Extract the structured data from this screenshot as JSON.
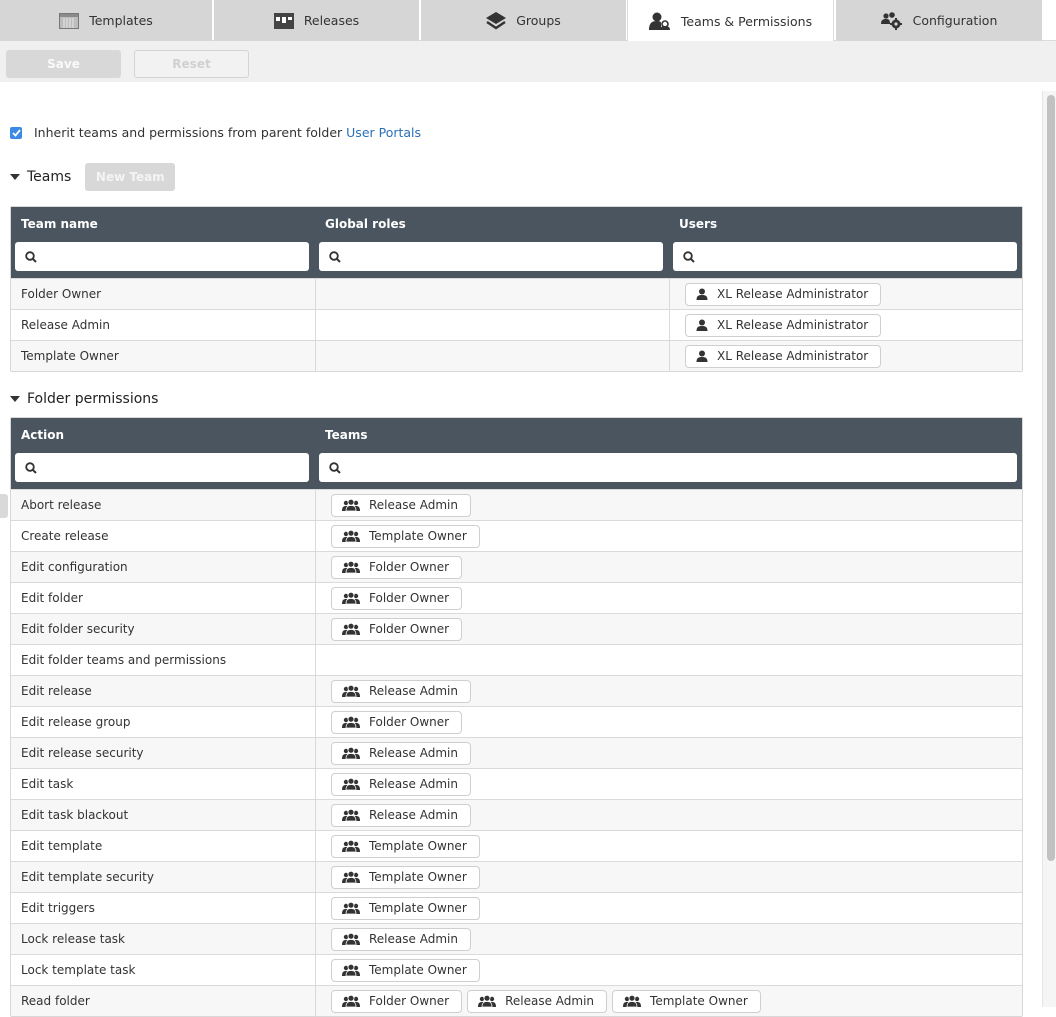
{
  "tabs": [
    {
      "label": "Templates",
      "icon": "templates-grid-icon",
      "active": false
    },
    {
      "label": "Releases",
      "icon": "releases-bars-icon",
      "active": false
    },
    {
      "label": "Groups",
      "icon": "layers-icon",
      "active": false
    },
    {
      "label": "Teams & Permissions",
      "icon": "user-lock-icon",
      "active": true
    },
    {
      "label": "Configuration",
      "icon": "users-cog-icon",
      "active": false
    }
  ],
  "toolbar": {
    "save_label": "Save",
    "reset_label": "Reset"
  },
  "inherit": {
    "checked": true,
    "text": "Inherit teams and permissions from parent folder",
    "link": "User Portals"
  },
  "teams": {
    "title": "Teams",
    "new_team_label": "New Team",
    "columns": [
      "Team name",
      "Global roles",
      "Users"
    ],
    "rows": [
      {
        "name": "Folder Owner",
        "global_roles": "",
        "users": [
          "XL Release Administrator"
        ]
      },
      {
        "name": "Release Admin",
        "global_roles": "",
        "users": [
          "XL Release Administrator"
        ]
      },
      {
        "name": "Template Owner",
        "global_roles": "",
        "users": [
          "XL Release Administrator"
        ]
      }
    ]
  },
  "permissions": {
    "title": "Folder permissions",
    "columns": [
      "Action",
      "Teams"
    ],
    "rows": [
      {
        "action": "Abort release",
        "teams": [
          "Release Admin"
        ]
      },
      {
        "action": "Create release",
        "teams": [
          "Template Owner"
        ]
      },
      {
        "action": "Edit configuration",
        "teams": [
          "Folder Owner"
        ]
      },
      {
        "action": "Edit folder",
        "teams": [
          "Folder Owner"
        ]
      },
      {
        "action": "Edit folder security",
        "teams": [
          "Folder Owner"
        ]
      },
      {
        "action": "Edit folder teams and permissions",
        "teams": []
      },
      {
        "action": "Edit release",
        "teams": [
          "Release Admin"
        ]
      },
      {
        "action": "Edit release group",
        "teams": [
          "Folder Owner"
        ]
      },
      {
        "action": "Edit release security",
        "teams": [
          "Release Admin"
        ]
      },
      {
        "action": "Edit task",
        "teams": [
          "Release Admin"
        ]
      },
      {
        "action": "Edit task blackout",
        "teams": [
          "Release Admin"
        ]
      },
      {
        "action": "Edit template",
        "teams": [
          "Template Owner"
        ]
      },
      {
        "action": "Edit template security",
        "teams": [
          "Template Owner"
        ]
      },
      {
        "action": "Edit triggers",
        "teams": [
          "Template Owner"
        ]
      },
      {
        "action": "Lock release task",
        "teams": [
          "Release Admin"
        ]
      },
      {
        "action": "Lock template task",
        "teams": [
          "Template Owner"
        ]
      },
      {
        "action": "Read folder",
        "teams": [
          "Folder Owner",
          "Release Admin",
          "Template Owner"
        ]
      }
    ]
  },
  "colors": {
    "header_bg": "#4a5560",
    "link": "#2a6fb9",
    "checkbox": "#3b8be6",
    "tab_bg": "#d6d6d6"
  }
}
